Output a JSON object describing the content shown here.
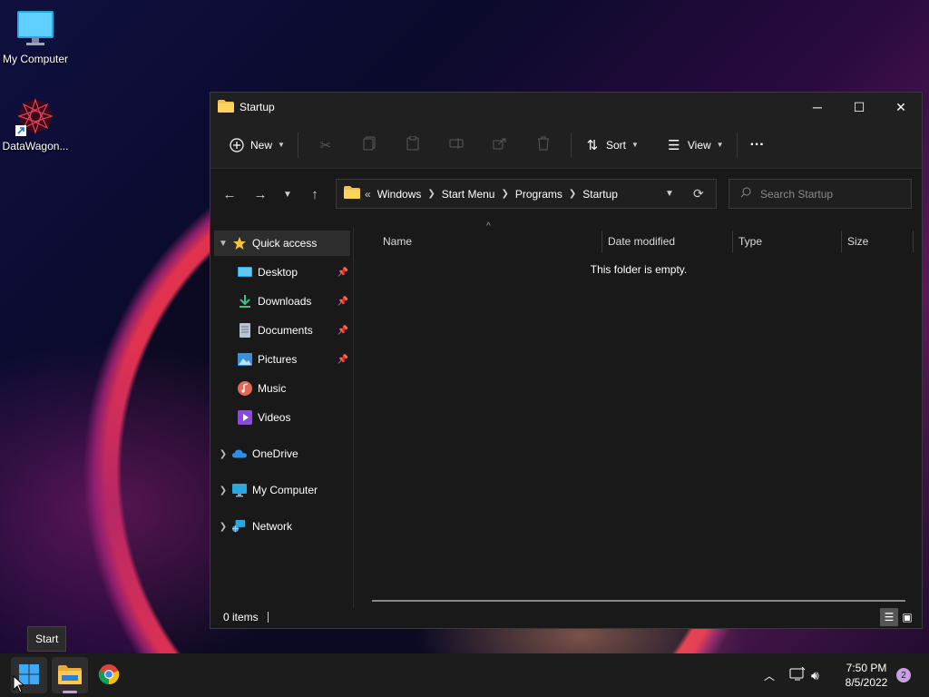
{
  "desktop": {
    "icons": [
      {
        "label": "My Computer",
        "icon": "monitor-icon"
      },
      {
        "label": "DataWagon...",
        "icon": "datawagon-shortcut-icon"
      }
    ]
  },
  "window": {
    "title": "Startup",
    "controls": {
      "minimize": "─",
      "maximize": "☐",
      "close": "✕"
    }
  },
  "toolbar": {
    "new_label": "New",
    "sort_label": "Sort",
    "view_label": "View",
    "more_label": "···"
  },
  "address": {
    "overflow": "«",
    "crumbs": [
      "Windows",
      "Start Menu",
      "Programs",
      "Startup"
    ]
  },
  "search": {
    "placeholder": "Search Startup"
  },
  "sidebar": {
    "items": [
      {
        "label": "Quick access",
        "icon": "star-icon"
      },
      {
        "label": "Desktop",
        "icon": "desktop-folder-icon",
        "pinned": true
      },
      {
        "label": "Downloads",
        "icon": "download-icon",
        "pinned": true
      },
      {
        "label": "Documents",
        "icon": "document-icon",
        "pinned": true
      },
      {
        "label": "Pictures",
        "icon": "pictures-icon",
        "pinned": true
      },
      {
        "label": "Music",
        "icon": "music-icon"
      },
      {
        "label": "Videos",
        "icon": "videos-icon"
      },
      {
        "label": "OneDrive",
        "icon": "cloud-icon"
      },
      {
        "label": "My Computer",
        "icon": "monitor-icon"
      },
      {
        "label": "Network",
        "icon": "network-icon"
      }
    ]
  },
  "columns": {
    "name": "Name",
    "date": "Date modified",
    "type": "Type",
    "size": "Size"
  },
  "content": {
    "empty_message": "This folder is empty."
  },
  "status": {
    "items": "0 items"
  },
  "tooltip": {
    "text": "Start"
  },
  "taskbar": {
    "clock_time": "7:50 PM",
    "clock_date": "8/5/2022",
    "notification_count": "2"
  }
}
